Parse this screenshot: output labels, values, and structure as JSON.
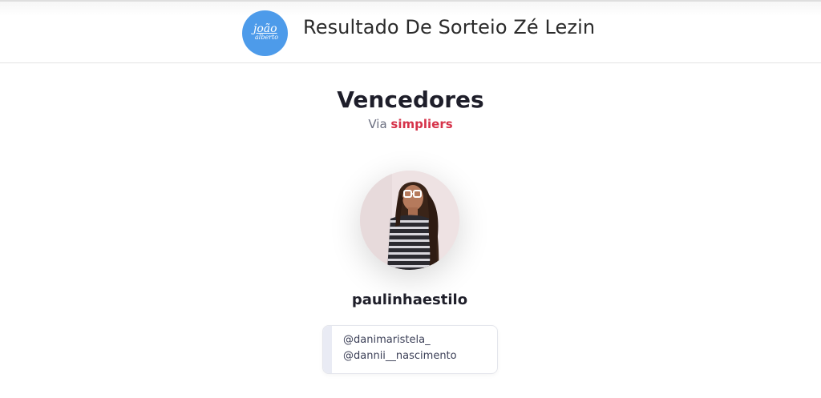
{
  "header": {
    "logo_line1": "joão",
    "logo_line2": "alberto",
    "title": "Resultado De Sorteio Zé Lezin",
    "colors": {
      "logo_bg": "#4d9bea"
    }
  },
  "main": {
    "heading": "Vencedores",
    "via_prefix": "Via",
    "via_brand": "simpliers",
    "colors": {
      "brand": "#d6334a"
    }
  },
  "winner": {
    "username": "paulinhaestilo",
    "tagged": [
      "@danimaristela_",
      "@dannii__nascimento"
    ]
  }
}
